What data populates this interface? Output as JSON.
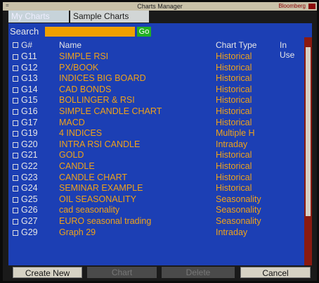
{
  "window": {
    "title": "Charts Manager",
    "brand": "Bloomberg",
    "sysmenu": "="
  },
  "tabs": [
    {
      "label": "My Charts",
      "active": false
    },
    {
      "label": "Sample Charts",
      "active": true
    }
  ],
  "search": {
    "label": "Search",
    "value": "",
    "go_label": "Go"
  },
  "table": {
    "headers": {
      "id": "G#",
      "name": "Name",
      "type": "Chart Type",
      "inuse": "In Use"
    },
    "rows": [
      {
        "id": "G11",
        "name": "SIMPLE RSI",
        "type": "Historical"
      },
      {
        "id": "G12",
        "name": "PX/BOOK",
        "type": "Historical"
      },
      {
        "id": "G13",
        "name": "INDICES BIG BOARD",
        "type": "Historical"
      },
      {
        "id": "G14",
        "name": "CAD BONDS",
        "type": "Historical"
      },
      {
        "id": "G15",
        "name": "BOLLINGER & RSI",
        "type": "Historical"
      },
      {
        "id": "G16",
        "name": "SIMPLE CANDLE CHART",
        "type": "Historical"
      },
      {
        "id": "G17",
        "name": "MACD",
        "type": "Historical"
      },
      {
        "id": "G19",
        "name": "4 INDICES",
        "type": "Multiple H"
      },
      {
        "id": "G20",
        "name": "INTRA RSI CANDLE",
        "type": "Intraday"
      },
      {
        "id": "G21",
        "name": "GOLD",
        "type": "Historical"
      },
      {
        "id": "G22",
        "name": "CANDLE",
        "type": "Historical"
      },
      {
        "id": "G23",
        "name": "CANDLE CHART",
        "type": "Historical"
      },
      {
        "id": "G24",
        "name": "SEMINAR EXAMPLE",
        "type": "Historical"
      },
      {
        "id": "G25",
        "name": "OIL SEASONALITY",
        "type": "Seasonality"
      },
      {
        "id": "G26",
        "name": "cad seasonality",
        "type": "Seasonality"
      },
      {
        "id": "G27",
        "name": "EURO seasonal trading",
        "type": "Seasonality"
      },
      {
        "id": "G29",
        "name": "Graph 29",
        "type": "Intraday"
      }
    ]
  },
  "buttons": {
    "create": "Create New",
    "chart": "Chart",
    "delete": "Delete",
    "cancel": "Cancel"
  }
}
